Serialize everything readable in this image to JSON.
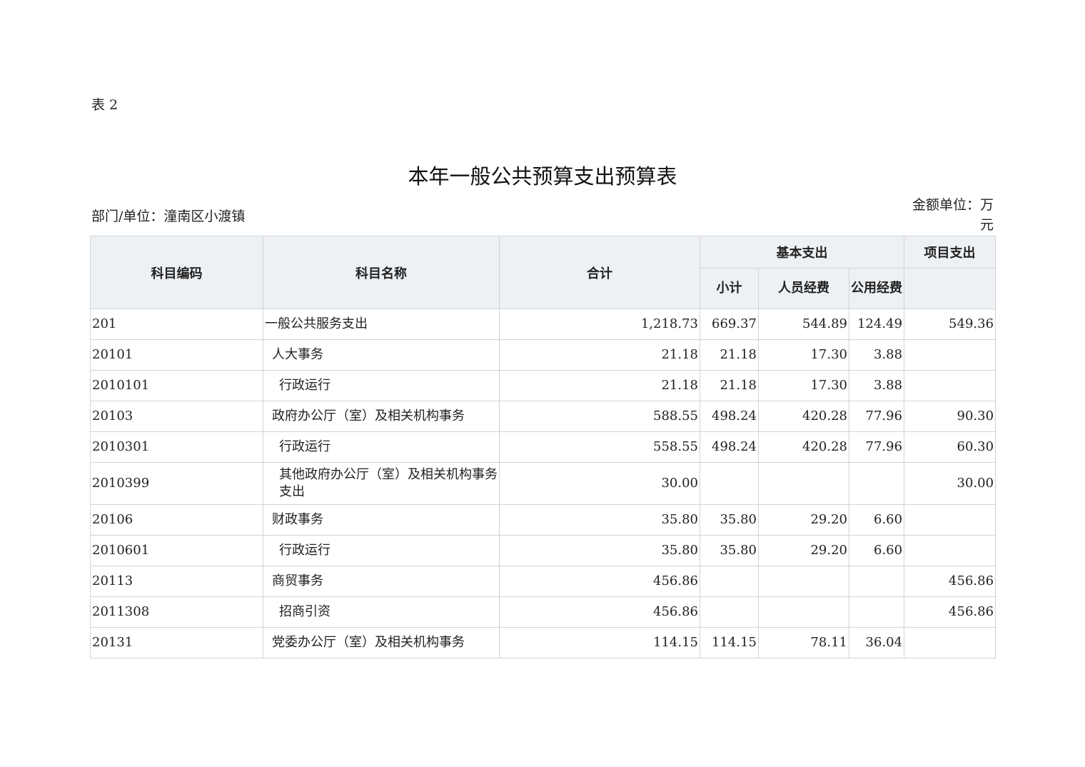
{
  "header": {
    "table_no": "表 2",
    "title": "本年一般公共预算支出预算表",
    "department": "部门/单位：潼南区小渡镇",
    "unit": "金额单位：万元"
  },
  "columns": {
    "code": "科目编码",
    "name": "科目名称",
    "total": "合计",
    "basic": "基本支出",
    "subtotal": "小计",
    "personnel": "人员经费",
    "public": "公用经费",
    "project": "项目支出"
  },
  "rows": [
    {
      "code": "201",
      "name": "一般公共服务支出",
      "level": 0,
      "total": "1,218.73",
      "subtotal": "669.37",
      "personnel": "544.89",
      "public": "124.49",
      "project": "549.36"
    },
    {
      "code": "20101",
      "name": "人大事务",
      "level": 1,
      "total": "21.18",
      "subtotal": "21.18",
      "personnel": "17.30",
      "public": "3.88",
      "project": ""
    },
    {
      "code": "2010101",
      "name": "行政运行",
      "level": 2,
      "total": "21.18",
      "subtotal": "21.18",
      "personnel": "17.30",
      "public": "3.88",
      "project": ""
    },
    {
      "code": "20103",
      "name": "政府办公厅（室）及相关机构事务",
      "level": 1,
      "total": "588.55",
      "subtotal": "498.24",
      "personnel": "420.28",
      "public": "77.96",
      "project": "90.30"
    },
    {
      "code": "2010301",
      "name": "行政运行",
      "level": 2,
      "total": "558.55",
      "subtotal": "498.24",
      "personnel": "420.28",
      "public": "77.96",
      "project": "60.30"
    },
    {
      "code": "2010399",
      "name": "其他政府办公厅（室）及相关机构事务支出",
      "level": 2,
      "total": "30.00",
      "subtotal": "",
      "personnel": "",
      "public": "",
      "project": "30.00"
    },
    {
      "code": "20106",
      "name": "财政事务",
      "level": 1,
      "total": "35.80",
      "subtotal": "35.80",
      "personnel": "29.20",
      "public": "6.60",
      "project": ""
    },
    {
      "code": "2010601",
      "name": "行政运行",
      "level": 2,
      "total": "35.80",
      "subtotal": "35.80",
      "personnel": "29.20",
      "public": "6.60",
      "project": ""
    },
    {
      "code": "20113",
      "name": "商贸事务",
      "level": 1,
      "total": "456.86",
      "subtotal": "",
      "personnel": "",
      "public": "",
      "project": "456.86"
    },
    {
      "code": "2011308",
      "name": "招商引资",
      "level": 2,
      "total": "456.86",
      "subtotal": "",
      "personnel": "",
      "public": "",
      "project": "456.86"
    },
    {
      "code": "20131",
      "name": "党委办公厅（室）及相关机构事务",
      "level": 1,
      "total": "114.15",
      "subtotal": "114.15",
      "personnel": "78.11",
      "public": "36.04",
      "project": ""
    }
  ]
}
